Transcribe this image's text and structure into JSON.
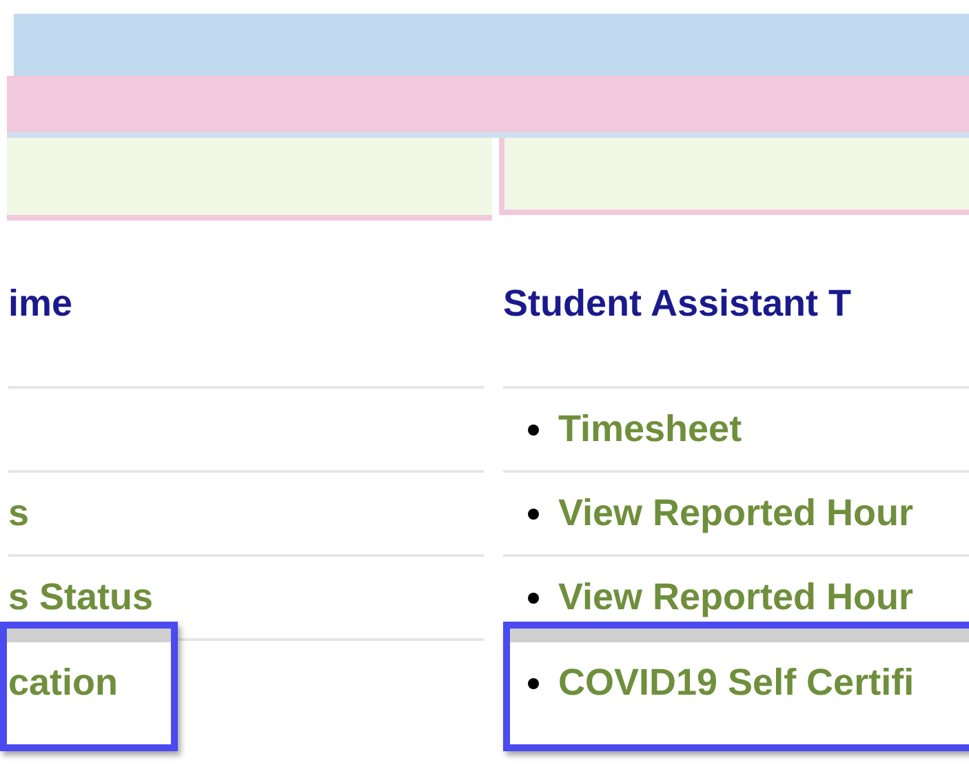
{
  "columns": [
    {
      "heading": "ime",
      "items": [
        {
          "highlighted": false
        },
        {
          "label": "s",
          "highlighted": false
        },
        {
          "label": "s Status",
          "highlighted": false
        },
        {
          "label": "cation",
          "highlighted": true
        }
      ]
    },
    {
      "heading": "Student Assistant T",
      "items": [
        {
          "label": "Timesheet",
          "highlighted": false
        },
        {
          "label": "View Reported Hour",
          "highlighted": false
        },
        {
          "label": "View Reported Hour",
          "highlighted": false
        },
        {
          "label": "COVID19 Self Certifi",
          "highlighted": true
        }
      ]
    }
  ]
}
